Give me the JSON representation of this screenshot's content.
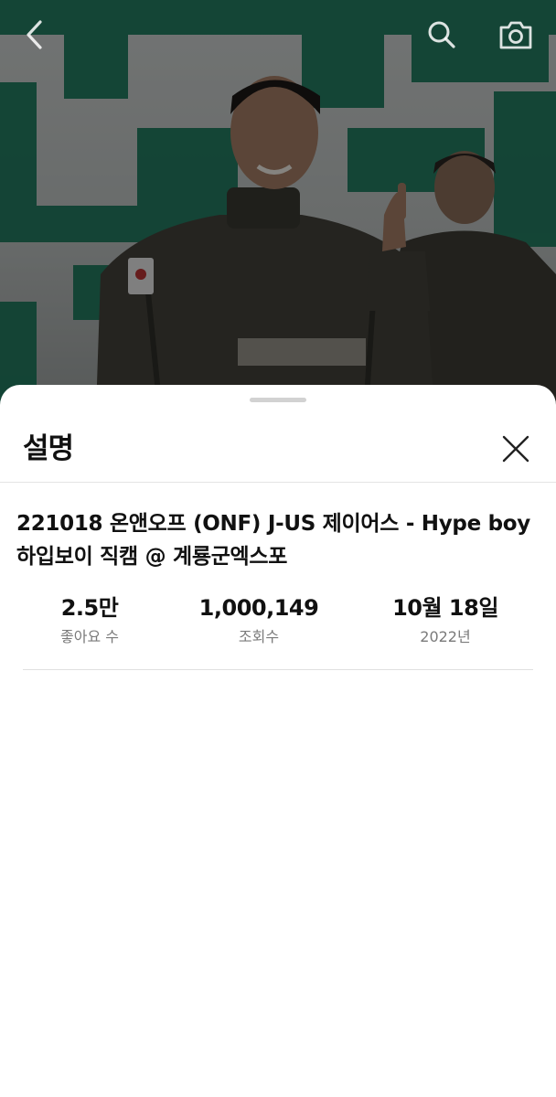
{
  "video": {
    "thumbnail_icon": "video-frame-soldiers"
  },
  "topbar": {
    "back_icon": "chevron-left-icon",
    "search_icon": "search-icon",
    "camera_icon": "camera-icon",
    "icon_color": "#ffffff"
  },
  "sheet": {
    "title": "설명",
    "close_icon": "close-icon",
    "video_title": "221018 온앤오프 (ONF) J-US 제이어스 - Hype boy 하입보이 직캠 @ 계룡군엑스포",
    "stats": {
      "likes": {
        "value": "2.5만",
        "label": "좋아요 수"
      },
      "views": {
        "value": "1,000,149",
        "label": "조회수"
      },
      "date": {
        "value": "10월 18일",
        "label": "2022년"
      }
    }
  }
}
